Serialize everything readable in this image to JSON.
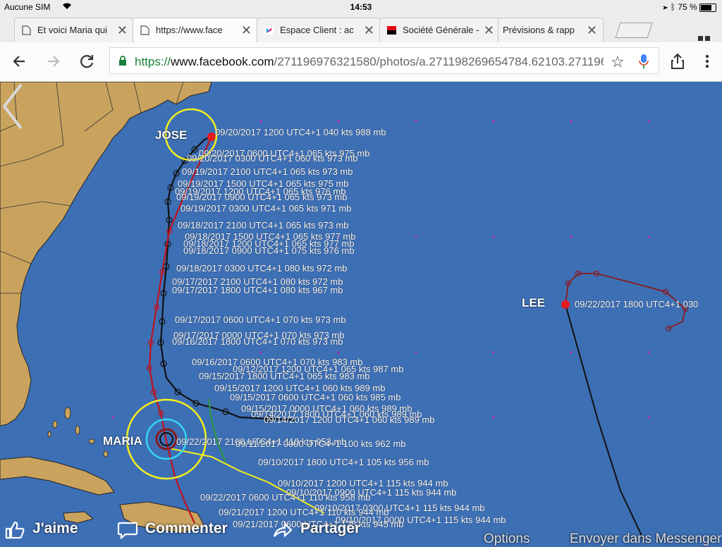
{
  "status_bar": {
    "carrier": "Aucune SIM",
    "time": "14:53",
    "battery": "75 %"
  },
  "tabs": [
    {
      "label": "Et voici Maria qui",
      "favicon": "facebook-favicon"
    },
    {
      "label": "https://www.face",
      "favicon": "page-favicon"
    },
    {
      "label": "Espace Client : ac",
      "favicon": "sfr-favicon"
    },
    {
      "label": "Société Générale -",
      "favicon": "societe-generale-favicon"
    },
    {
      "label": "Prévisions & rapp",
      "favicon": "none"
    }
  ],
  "omnibox": {
    "scheme": "https://",
    "host": "www.facebook.com",
    "path": "/271196976321580/photos/a.271198269654784.62103.2711969"
  },
  "storms": {
    "jose": "JOSE",
    "lee": "LEE",
    "maria": "MARIA"
  },
  "track_labels": {
    "jose_top": "09/20/2017 1200 UTC4+1 040  kts 988 mb",
    "jose_1": "09/20/2017 0600 UTC4+1 065  kts 975 mb",
    "jose_2": "09/20/2017 0300 UTC4+1 060  kts 973 mb",
    "jose_3": "09/19/2017 2100 UTC4+1 065  kts 973 mb",
    "jose_4": "09/19/2017 1500 UTC4+1 065  kts 975 mb",
    "jose_5": "09/19/2017 1200 UTC4+1 065  kts 976 mb",
    "jose_6": "09/19/2017 0900 UTC4+1 065  kts 973 mb",
    "jose_7": "09/19/2017 0300 UTC4+1 065  kts 971 mb",
    "jose_8": "09/18/2017 2100 UTC4+1 065  kts 973 mb",
    "jose_9": "09/18/2017 1500 UTC4+1 065  kts 977 mb",
    "jose_10": "09/18/2017 1200 UTC4+1 065  kts 977 mb",
    "jose_11": "09/18/2017 0900 UTC4+1 075  kts 976 mb",
    "jose_12": "09/18/2017 0300 UTC4+1 080  kts 972 mb",
    "jose_13": "09/17/2017 2100 UTC4+1 080  kts 972 mb",
    "jose_14": "09/17/2017 1800 UTC4+1 080  kts 967 mb",
    "jose_15": "09/17/2017 0600 UTC4+1 070  kts 973 mb",
    "jose_16": "09/17/2017 0000 UTC4+1 070  kts 973 mb",
    "jose_17": "09/16/2017 1800 UTC4+1 070  kts 973 mb",
    "jose_18": "09/16/2017 0600 UTC4+1 070  kts 983 mb",
    "jose_19": "09/12/2017 1200 UTC4+1 065  kts 987 mb",
    "jose_20": "09/15/2017 1800 UTC4+1 065  kts 983 mb",
    "jose_21": "09/15/2017 1200 UTC4+1 060  kts 989 mb",
    "jose_22": "09/15/2017 0600 UTC4+1 060  kts 985 mb",
    "jose_23": "09/15/2017 0000 UTC4+1 060  kts 989 mb",
    "jose_24": "09/14/2017 1800 UTC4+1 060  kts 989 mb",
    "jose_25": "09/14/2017 1200 UTC4+1 060  kts 989 mb",
    "lee": "09/22/2017 1800 UTC4+1 030",
    "maria_top": "09/22/2017 2100 UTC4+1 110  kts 953 mb",
    "maria_1": "09/11/2017 0000 UTC4+1 100  kts 962 mb",
    "maria_2": "09/10/2017 1800 UTC4+1 105  kts 956 mb",
    "maria_3": "09/10/2017 1200 UTC4+1 115  kts 944 mb",
    "maria_4": "09/10/2017 0900 UTC4+1 115  kts 944 mb",
    "maria_5": "09/22/2017 0600 UTC4+1 110  kts 958 mb",
    "maria_6": "09/10/2017 0300 UTC4+1 115  kts 944 mb",
    "maria_7": "09/21/2017 1200 UTC4+1 110  kts 944 mb",
    "maria_8": "09/10/2017 0000 UTC4+1 115  kts 944 mb",
    "maria_9": "09/21/2017 0600 UTC4+1 125  kts 945 mb"
  },
  "actions": {
    "like": "J'aime",
    "comment": "Commenter",
    "share": "Partager",
    "options": "Options",
    "send": "Envoyer dans Messenger"
  },
  "colors": {
    "ocean": "#3d6fb5",
    "land": "#c9a35e",
    "track_jose": "#111111",
    "track_maria": "#c0121e",
    "circle_outer": "#f5ef1c",
    "circle_inner": "#36d6f0"
  }
}
